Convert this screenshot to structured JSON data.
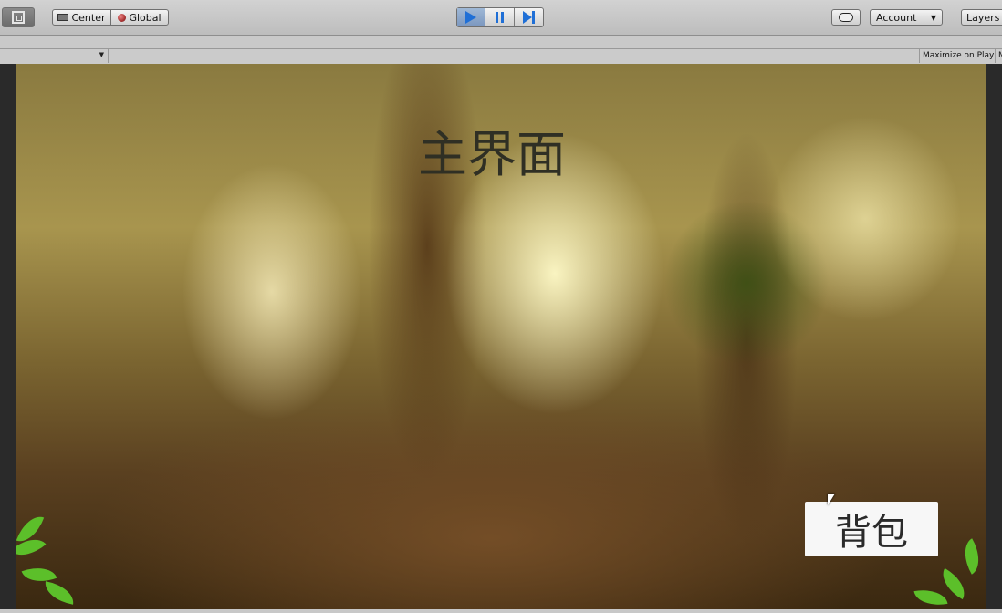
{
  "toolbar": {
    "pivot_center_label": "Center",
    "pivot_global_label": "Global",
    "account_label": "Account",
    "layers_label": "Layers",
    "caret_glyph": "▼"
  },
  "game_toolbar": {
    "maximize_label": "Maximize on Play",
    "truncated_label": "M"
  },
  "game": {
    "title": "主界面",
    "bag_button_label": "背包"
  },
  "icons": [
    "rect-tool-icon",
    "pivot-center-icon",
    "global-icon",
    "play-icon",
    "pause-icon",
    "step-icon",
    "cloud-icon",
    "cursor-icon"
  ],
  "colors": {
    "play_accent": "#1f6fd6",
    "title_text": "#2f2f24",
    "bag_button_bg": "#f7f7f7"
  }
}
